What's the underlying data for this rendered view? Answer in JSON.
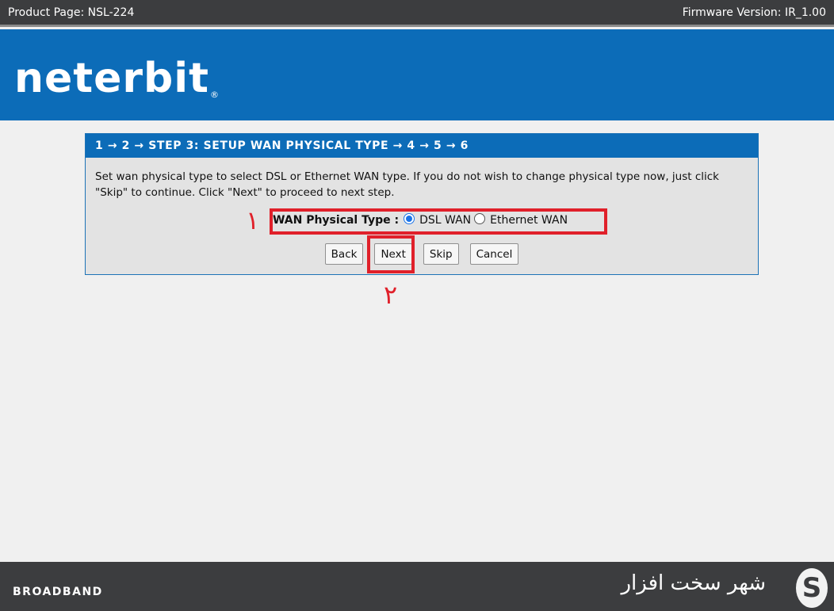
{
  "topbar": {
    "product": "Product Page: NSL-224",
    "firmware": "Firmware Version: IR_1.00"
  },
  "brand": {
    "logo": "neterbit",
    "logo_mark": "®"
  },
  "wizard": {
    "header": "1 → 2 → STEP 3: SETUP WAN PHYSICAL TYPE → 4 → 5 → 6",
    "description": "Set wan physical type to select DSL or Ethernet WAN type. If you do not wish to change physical type now, just click \"Skip\" to continue. Click \"Next\" to proceed to next step.",
    "wan_label": "WAN Physical Type :",
    "options": [
      {
        "label": "DSL WAN",
        "selected": true
      },
      {
        "label": "Ethernet WAN",
        "selected": false
      }
    ],
    "buttons": {
      "back": "Back",
      "next": "Next",
      "skip": "Skip",
      "cancel": "Cancel"
    }
  },
  "annotations": {
    "mark1": "١",
    "mark2": "٢",
    "color": "#e0202a"
  },
  "footer": {
    "brand": "BROADBAND",
    "watermark_text": "شهر سخت افزار",
    "watermark_mark": "S"
  },
  "colors": {
    "topbar": "#3c3d3f",
    "banner": "#0c6cb8",
    "panel": "#e3e3e3"
  }
}
